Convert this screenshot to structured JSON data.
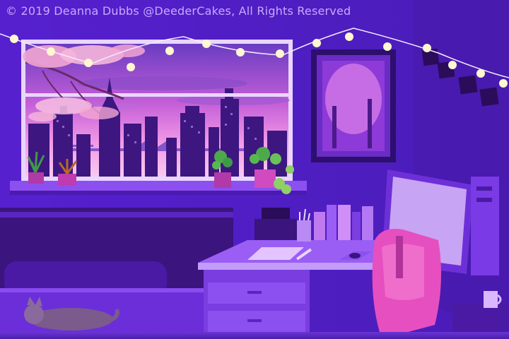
{
  "artwork": {
    "copyright": "© 2019 Deanna Dubbs @DeederCakes, All Rights Reserved"
  },
  "palette": {
    "wall": "#5a24d8",
    "wall_dark": "#3b17a0",
    "sky_top": "#6a3cc2",
    "sky_glow": "#f06ad8",
    "city": "#3a1478",
    "desk": "#8e52f0",
    "chair": "#e64fc0",
    "monitor_screen": "#c8a4f4",
    "lights": "#fff6d2",
    "plants": "#4caa4a"
  },
  "icons": [
    "cat-icon",
    "string-lights-icon",
    "desktop-computer-icon",
    "desk-lamp-icon",
    "potted-plant-icon",
    "coffee-mug-icon"
  ]
}
